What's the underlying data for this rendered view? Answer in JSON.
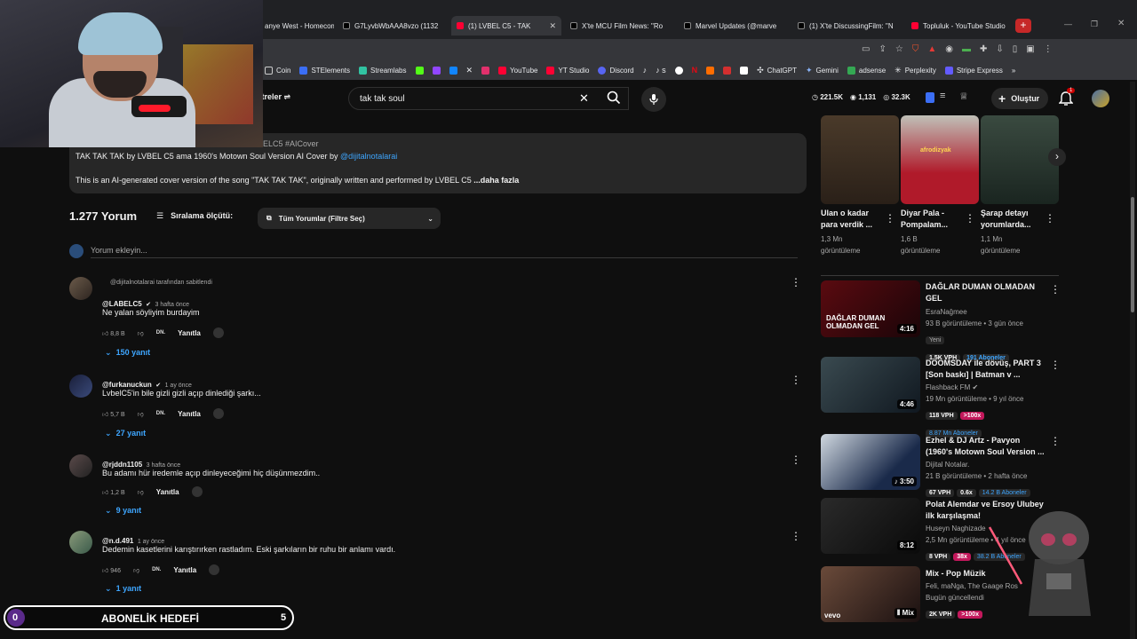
{
  "tabs": [
    {
      "label": "anye West - Homecom",
      "active": false
    },
    {
      "label": "G7LyvbWbAAA8vzo (1132",
      "active": false
    },
    {
      "label": "(1) LVBEL C5 - TAK",
      "active": true
    },
    {
      "label": "X'te MCU Film News: \"Ro",
      "active": false
    },
    {
      "label": "Marvel Updates (@marve",
      "active": false
    },
    {
      "label": "(1) X'te DiscussingFilm: \"N",
      "active": false
    },
    {
      "label": "Topluluk - YouTube Studio",
      "active": false
    }
  ],
  "bookmarks": [
    "Coin",
    "STElements",
    "Streamlabs",
    "YouTube",
    "YT Studio",
    "Discord",
    "ChatGPT",
    "Gemini",
    "adsense",
    "Perplexity",
    "Stripe Express"
  ],
  "header": {
    "filters_label": "ltreler",
    "search_value": "tak tak soul",
    "stats": [
      "221.5K",
      "1,131",
      "32.3K"
    ],
    "create_label": "Oluştur",
    "notif_count": "1"
  },
  "description": {
    "tags": "VBELC5 #AICover",
    "line1_prefix": "TAK TAK TAK by LVBEL C5 ama 1960's Motown Soul Version AI Cover by ",
    "line1_link": "@dijitalnotalarai",
    "line2": "This is an AI-generated cover version of the song \"TAK TAK TAK\", originally written and performed by LVBEL C5",
    "more": "...daha fazla"
  },
  "comments_header": {
    "count": "1.277 Yorum",
    "sort_label": "Sıralama ölçütü:",
    "filter_label": "Tüm Yorumlar (Filtre Seç)",
    "add_placeholder": "Yorum ekleyin..."
  },
  "comments": [
    {
      "pinned": "@dijitalnotalarai tarafından sabitlendi",
      "author": "@LABELC5",
      "time": "3 hafta önce",
      "text": "Ne yalan söyliyim burdayim",
      "likes": "8,8 B",
      "reply": "Yanıtla",
      "replies": "150 yanıt"
    },
    {
      "author": "@furkanuckun",
      "time": "1 ay önce",
      "text": "LvbelC5'in bile gizli gizli açıp dinlediği şarkı...",
      "likes": "5,7 B",
      "reply": "Yanıtla",
      "replies": "27 yanıt"
    },
    {
      "author": "@rjddn1105",
      "time": "3 hafta önce",
      "text": "Bu adamı hür iredemle açıp dinleyeceğimi hiç düşünmezdim..",
      "likes": "1,2 B",
      "reply": "Yanıtla",
      "replies": "9 yanıt"
    },
    {
      "author": "@n.d.491",
      "time": "1 ay önce",
      "text": "Dedemin kasetlerini karıştırırken rastladım. Eski şarkıların bir ruhu bir anlamı vardı.",
      "likes": "946",
      "reply": "Yanıtla",
      "replies": "1 yanıt"
    }
  ],
  "dn_badge": "DN.",
  "shorts": [
    {
      "title1": "Ulan o kadar",
      "title2": "para verdik ...",
      "views": "1,3 Mn",
      "views_label": "görüntüleme"
    },
    {
      "title1": "Diyar Pala -",
      "title2": "Pompalam...",
      "views": "1,6 B",
      "views_label": "görüntüleme",
      "overlay": "afrodizyak"
    },
    {
      "title1": "Şarap detayı",
      "title2": "yorumlarda...",
      "views": "1,1 Mn",
      "views_label": "görüntüleme"
    }
  ],
  "videos": [
    {
      "title": "DAĞLAR DUMAN OLMADAN GEL",
      "channel": "EsraNağmee",
      "meta": "93 B görüntüleme • 3 gün önce",
      "badge": "Yeni",
      "vph": "1.5K VPH",
      "subs": "191 Aboneler",
      "duration": "4:16",
      "thumb_text": "DAĞLAR DUMAN OLMADAN GEL"
    },
    {
      "title": "DOOMSDAY ile dövüş, PART 3 [Son baskı] | Batman v ...",
      "channel": "Flashback FM",
      "meta": "19 Mn görüntüleme • 9 yıl önce",
      "vph": "118 VPH",
      "ratio": ">100x",
      "subs": "8.87 Mn Aboneler",
      "duration": "4:46"
    },
    {
      "title": "Ezhel & DJ Artz - Pavyon (1960's Motown Soul Version ...",
      "channel": "Dijital Notalar.",
      "meta": "21 B görüntüleme • 2 hafta önce",
      "vph": "67 VPH",
      "ratio": "0.6x",
      "subs": "14.2 B Aboneler",
      "duration": "3:50"
    },
    {
      "title": "Polat Alemdar ve Ersoy Ulubey ilk karşılaşma!",
      "channel": "Huseyn Naghizade",
      "meta": "2,5 Mn görüntüleme • 4 yıl önce",
      "vph": "8 VPH",
      "ratio": "38x",
      "subs": "38.2 B Aboneler",
      "duration": "8:12"
    },
    {
      "title": "Mix - Pop Müzik",
      "channel": "Feli, maNga, The Gaage Ros",
      "meta": "Bugün güncellendi",
      "vph": "2K VPH",
      "ratio": ">100x",
      "duration": "Mix",
      "logo": "vevo"
    }
  ],
  "goal": {
    "label": "ABONELİK HEDEFİ",
    "start": "0",
    "end": "5"
  },
  "colors": {
    "bg": "#0f0f0f",
    "link": "#3ea6ff",
    "accent_red": "#ff0033"
  }
}
